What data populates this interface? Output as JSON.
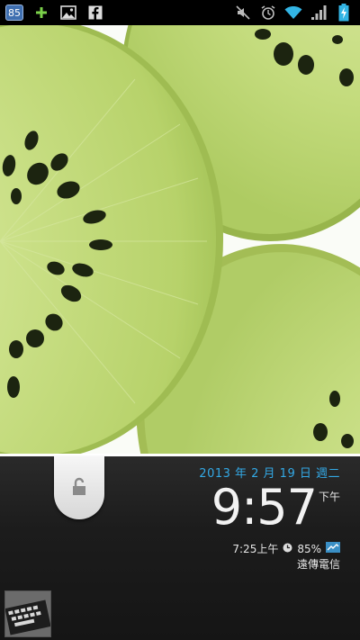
{
  "status_bar": {
    "notification_count": "85",
    "icons_left": [
      "calendar-badge-icon",
      "plus-icon",
      "gallery-icon",
      "facebook-icon"
    ],
    "icons_right": [
      "mute-icon",
      "alarm-icon",
      "wifi-icon",
      "signal-icon",
      "battery-charging-icon"
    ]
  },
  "lockscreen": {
    "date": "2013 年 2 月 19 日 週二",
    "time": "9:57",
    "ampm": "下午",
    "alarm_time": "7:25上午",
    "battery": "85%",
    "carrier": "遠傳電信",
    "unlock_icon": "unlock-icon"
  },
  "colors": {
    "accent_blue": "#33a9e6",
    "kiwi_green": "#c8e08a",
    "panel_bg": "#1c1c1c"
  }
}
